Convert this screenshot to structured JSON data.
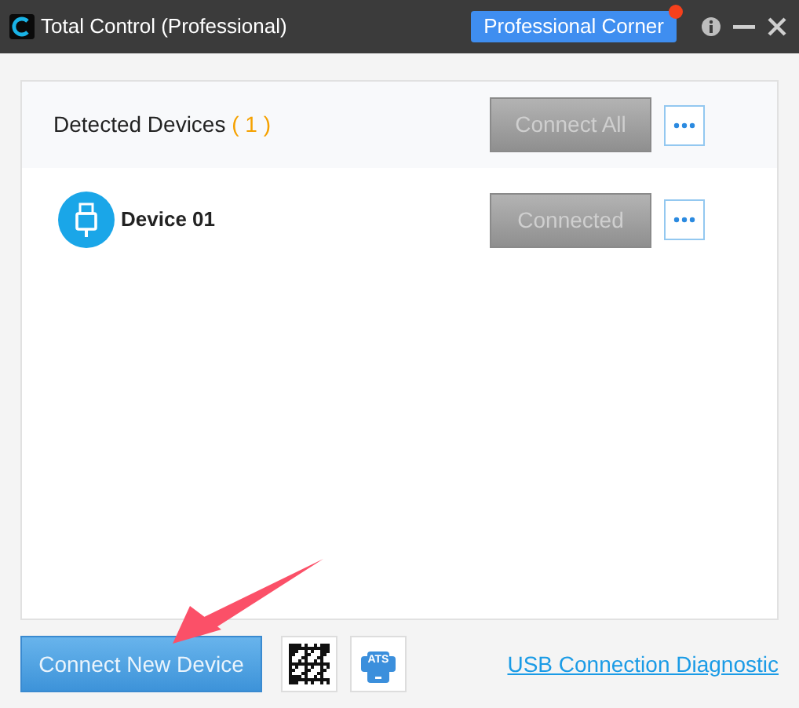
{
  "window": {
    "title": "Total Control (Professional)"
  },
  "professional_corner": {
    "label": "Professional Corner",
    "notification": true
  },
  "header": {
    "title": "Detected Devices",
    "count": "( 1 )",
    "connect_all": {
      "label": "Connect All",
      "disabled": true
    }
  },
  "devices": [
    {
      "name": "Device 01",
      "button": {
        "label": "Connected",
        "disabled": true
      }
    }
  ],
  "footer": {
    "connect_new": "Connect New Device",
    "ats_label": "ATS",
    "diagnostic_link": "USB Connection Diagnostic"
  }
}
